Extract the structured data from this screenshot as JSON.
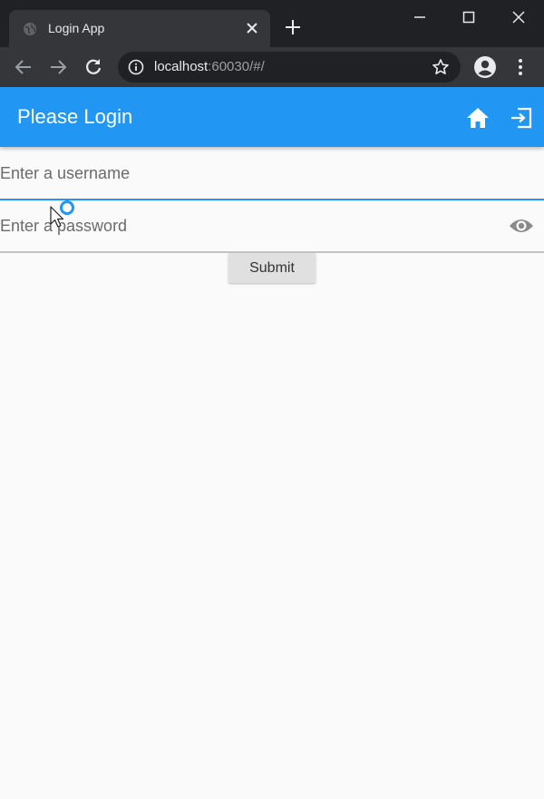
{
  "browser": {
    "tab_title": "Login App",
    "url_host": "localhost",
    "url_rest": ":60030/#/"
  },
  "icons": {
    "favicon": "globe-icon",
    "tab_close": "close-icon",
    "new_tab": "plus-icon",
    "minimize": "minimize-icon",
    "maximize": "maximize-icon",
    "close_window": "close-icon",
    "back": "arrow-left-icon",
    "forward": "arrow-right-icon",
    "reload": "reload-icon",
    "site_info": "info-icon",
    "bookmark": "star-icon",
    "account": "account-icon",
    "menu": "more-vertical-icon",
    "home": "home-icon",
    "logout": "logout-icon",
    "visibility": "eye-icon"
  },
  "appbar": {
    "title": "Please Login"
  },
  "form": {
    "username_placeholder": "Enter a username",
    "username_value": "",
    "password_placeholder": "Enter a password",
    "password_value": "",
    "submit_label": "Submit"
  },
  "colors": {
    "primary": "#2196f3",
    "chrome_dark": "#202124",
    "chrome_tab": "#35363a",
    "background": "#fafafa"
  }
}
